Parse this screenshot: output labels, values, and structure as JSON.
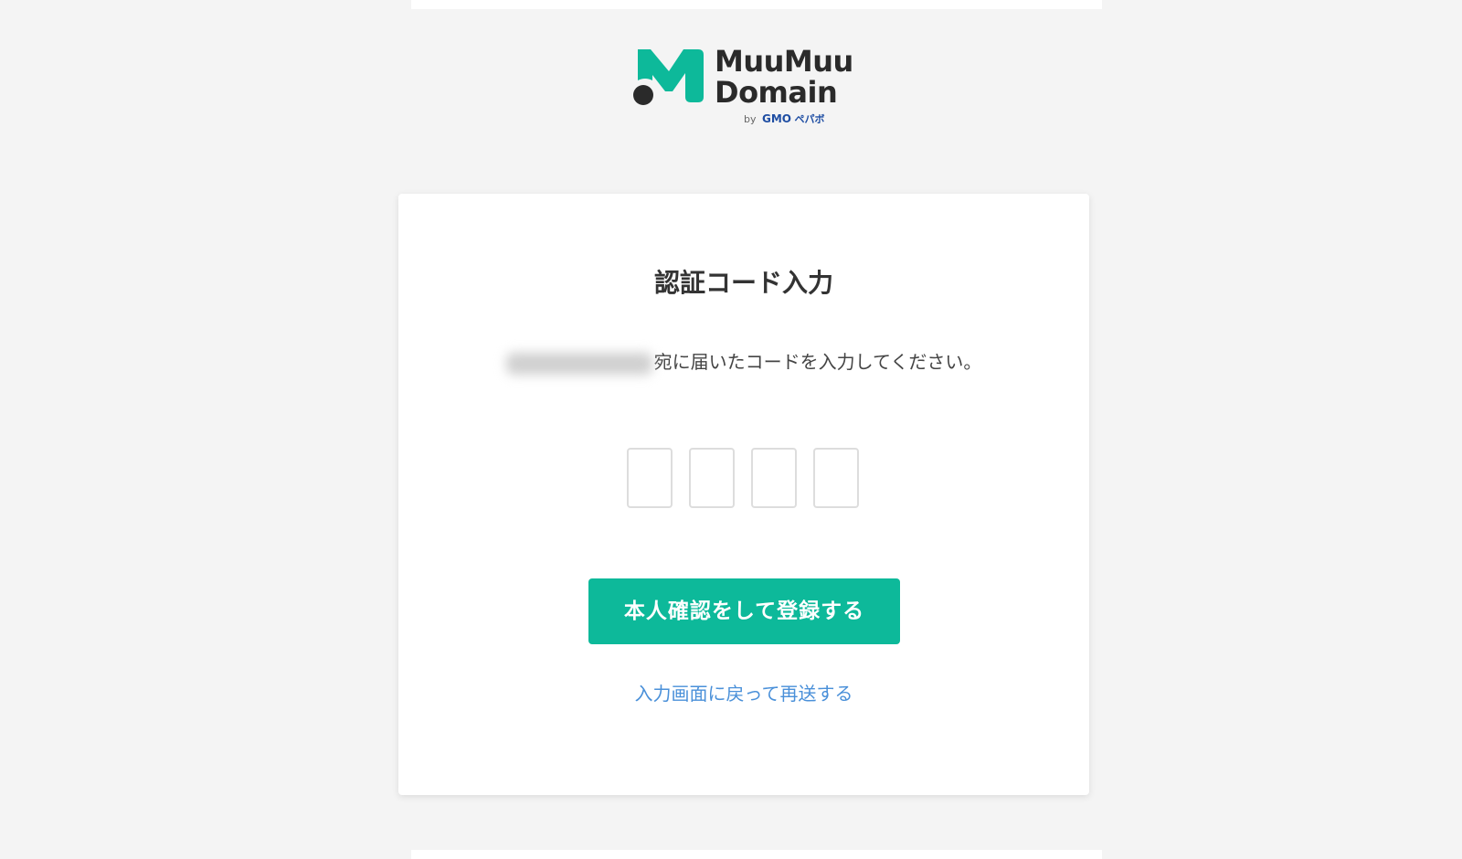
{
  "brand": {
    "name_line1": "MuuMuu",
    "name_line2": "Domain",
    "by": "by",
    "gmo": "GMO",
    "pepabo": "ペパボ",
    "accent_color": "#0db99a",
    "dot_color": "#2a2a2a"
  },
  "card": {
    "title": "認証コード入力",
    "instruction_suffix": "宛に届いたコードを入力してください。",
    "code_input_count": 4,
    "submit_label": "本人確認をして登録する",
    "resend_label": "入力画面に戻って再送する",
    "button_color": "#0db99a",
    "link_color": "#4a90d9"
  }
}
